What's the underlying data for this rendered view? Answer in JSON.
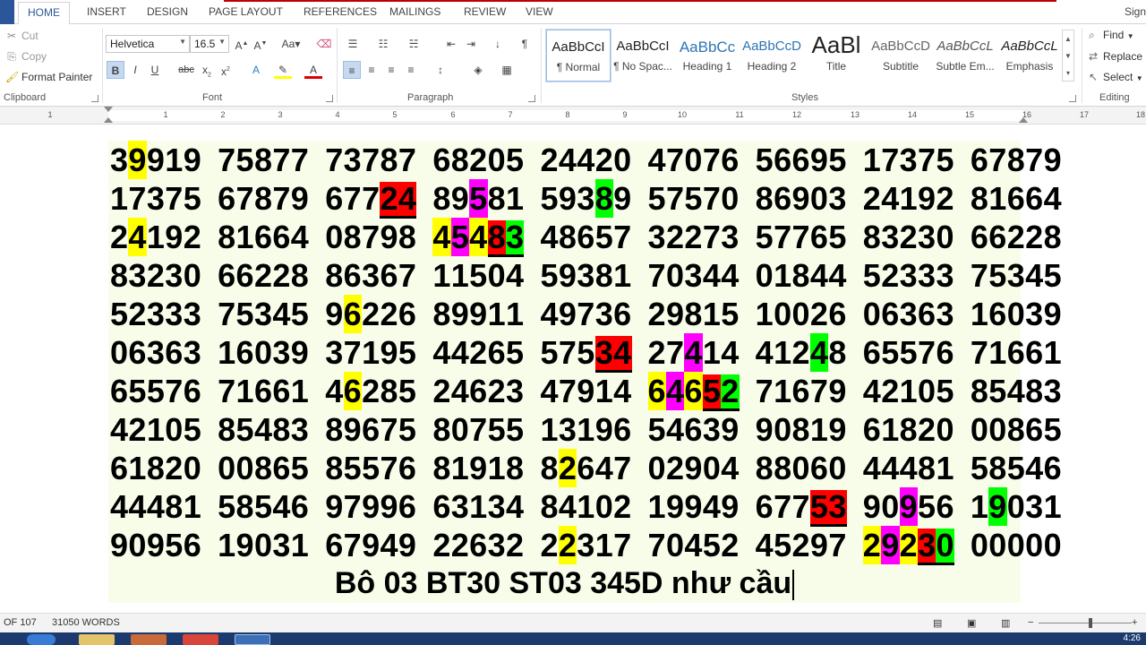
{
  "tabs": [
    "HOME",
    "INSERT",
    "DESIGN",
    "PAGE LAYOUT",
    "REFERENCES",
    "MAILINGS",
    "REVIEW",
    "VIEW"
  ],
  "signin": "Sign",
  "clipboard": {
    "cut": "Cut",
    "copy": "Copy",
    "painter": "Format Painter",
    "label": "Clipboard"
  },
  "font": {
    "name": "Helvetica",
    "size": "16.5",
    "label": "Font"
  },
  "paragraph": {
    "label": "Paragraph"
  },
  "styles": {
    "label": "Styles",
    "items": [
      {
        "sample": "AaBbCcI",
        "name": "¶ Normal"
      },
      {
        "sample": "AaBbCcI",
        "name": "¶ No Spac..."
      },
      {
        "sample": "AaBbCc",
        "name": "Heading 1"
      },
      {
        "sample": "AaBbCcD",
        "name": "Heading 2"
      },
      {
        "sample": "AaBl",
        "name": "Title"
      },
      {
        "sample": "AaBbCcD",
        "name": "Subtitle"
      },
      {
        "sample": "AaBbCcL",
        "name": "Subtle Em..."
      },
      {
        "sample": "AaBbCcL",
        "name": "Emphasis"
      }
    ]
  },
  "editing": {
    "find": "Find",
    "replace": "Replace",
    "select": "Select",
    "label": "Editing"
  },
  "ruler_numbers": [
    "1",
    "1",
    "2",
    "3",
    "4",
    "5",
    "6",
    "7",
    "8",
    "9",
    "10",
    "11",
    "12",
    "13",
    "14",
    "15",
    "16",
    "17",
    "18"
  ],
  "document": {
    "lines": [
      "39919 75877 73787 68205 24420 47076 56695 17375 67879",
      "17375 67879 67724 89581 59389 57570 86903 24192 81664",
      "24192 81664 08798 45483 48657 32273 57765 83230 66228",
      "83230 66228 86367 11504 59381 70344 01844 52333 75345",
      "52333 75345 96226 89911 49736 29815 10026 06363 16039",
      "06363 16039 37195 44265 57534 27414 41248 65576 71661",
      "65576 71661 46285 24623 47914 64652 71679 42105 85483",
      "42105 85483 89675 80755 13196 54639 90819 61820 00865",
      "61820 00865 85576 81918 82647 02904 88060 44481 58546",
      "44481 58546 97996 63134 84102 19949 67753 90956 19031",
      "90956 19031 67949 22632 22317 70452 45297 29230 00000"
    ],
    "highlights": [
      [
        [
          0,
          1,
          "y"
        ]
      ],
      [
        [
          2,
          3,
          "r"
        ],
        [
          2,
          4,
          "r"
        ],
        [
          3,
          2,
          "m"
        ],
        [
          4,
          3,
          "gr"
        ]
      ],
      [
        [
          0,
          1,
          "y"
        ],
        [
          3,
          0,
          "y"
        ],
        [
          3,
          1,
          "m"
        ],
        [
          3,
          2,
          "y"
        ],
        [
          3,
          3,
          "r"
        ],
        [
          3,
          4,
          "gr"
        ]
      ],
      [],
      [
        [
          2,
          1,
          "y"
        ]
      ],
      [
        [
          4,
          3,
          "r"
        ],
        [
          4,
          4,
          "r"
        ],
        [
          5,
          2,
          "m"
        ],
        [
          6,
          3,
          "gr"
        ]
      ],
      [
        [
          2,
          1,
          "y"
        ],
        [
          5,
          0,
          "y"
        ],
        [
          5,
          1,
          "m"
        ],
        [
          5,
          2,
          "y"
        ],
        [
          5,
          3,
          "r"
        ],
        [
          5,
          4,
          "gr"
        ]
      ],
      [],
      [
        [
          4,
          1,
          "y"
        ]
      ],
      [
        [
          6,
          3,
          "r"
        ],
        [
          6,
          4,
          "r"
        ],
        [
          7,
          2,
          "m"
        ],
        [
          8,
          1,
          "gr"
        ]
      ],
      [
        [
          4,
          1,
          "y"
        ],
        [
          7,
          0,
          "y"
        ],
        [
          7,
          1,
          "m"
        ],
        [
          7,
          2,
          "y"
        ],
        [
          7,
          3,
          "r"
        ],
        [
          7,
          4,
          "gr"
        ]
      ]
    ],
    "underlines": [
      [],
      [
        [
          2,
          3
        ],
        [
          2,
          4
        ]
      ],
      [
        [
          3,
          3
        ],
        [
          3,
          4
        ]
      ],
      [],
      [],
      [
        [
          4,
          3
        ],
        [
          4,
          4
        ]
      ],
      [
        [
          5,
          3
        ],
        [
          5,
          4
        ]
      ],
      [],
      [],
      [
        [
          6,
          3
        ],
        [
          6,
          4
        ]
      ],
      [
        [
          7,
          3
        ],
        [
          7,
          4
        ]
      ]
    ],
    "note": "Bô 03 BT30 ST03  345D như cầu"
  },
  "status": {
    "pages": "OF 107",
    "words": "31050 WORDS"
  },
  "clock": "4:26"
}
